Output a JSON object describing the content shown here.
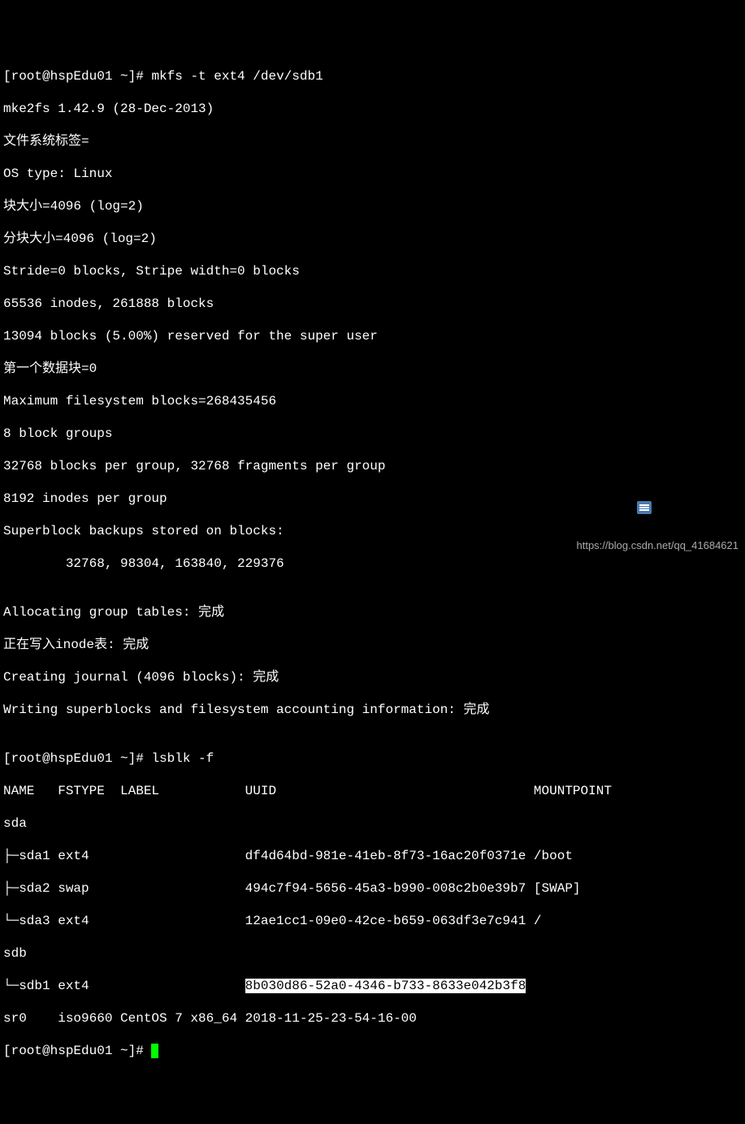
{
  "prompt1": "[root@hspEdu01 ~]# ",
  "cmd1": "mkfs -t ext4 /dev/sdb1",
  "mkfs_out": {
    "l1": "mke2fs 1.42.9 (28-Dec-2013)",
    "l2": "文件系统标签=",
    "l3": "OS type: Linux",
    "l4": "块大小=4096 (log=2)",
    "l5": "分块大小=4096 (log=2)",
    "l6": "Stride=0 blocks, Stripe width=0 blocks",
    "l7": "65536 inodes, 261888 blocks",
    "l8": "13094 blocks (5.00%) reserved for the super user",
    "l9": "第一个数据块=0",
    "l10": "Maximum filesystem blocks=268435456",
    "l11": "8 block groups",
    "l12": "32768 blocks per group, 32768 fragments per group",
    "l13": "8192 inodes per group",
    "l14": "Superblock backups stored on blocks: ",
    "l15": "        32768, 98304, 163840, 229376",
    "blank1": "",
    "l16": "Allocating group tables: 完成                            ",
    "l17": "正在写入inode表: 完成                            ",
    "l18": "Creating journal (4096 blocks): 完成",
    "l19": "Writing superblocks and filesystem accounting information: 完成 ",
    "blank2": ""
  },
  "prompt2": "[root@hspEdu01 ~]# ",
  "cmd2": "lsblk -f",
  "lsblk": {
    "header": "NAME   FSTYPE  LABEL           UUID                                 MOUNTPOINT",
    "sda": "sda                                                                  ",
    "sda1": "├─sda1 ext4                    df4d64bd-981e-41eb-8f73-16ac20f0371e /boot",
    "sda2": "├─sda2 swap                    494c7f94-5656-45a3-b990-008c2b0e39b7 [SWAP]",
    "sda3": "└─sda3 ext4                    12ae1cc1-09e0-42ce-b659-063df3e7c941 /",
    "sdb": "sdb                                                                  ",
    "sdb1_prefix": "└─sdb1 ext4                    ",
    "sdb1_uuid_hl": "8b030d86-52a0-4346-b733-8633e042b3f8",
    "sdb1_suffix": " ",
    "sr0": "sr0    iso9660 CentOS 7 x86_64 2018-11-25-23-54-16-00               "
  },
  "prompt3": "[root@hspEdu01 ~]# ",
  "watermark": "https://blog.csdn.net/qq_41684621"
}
